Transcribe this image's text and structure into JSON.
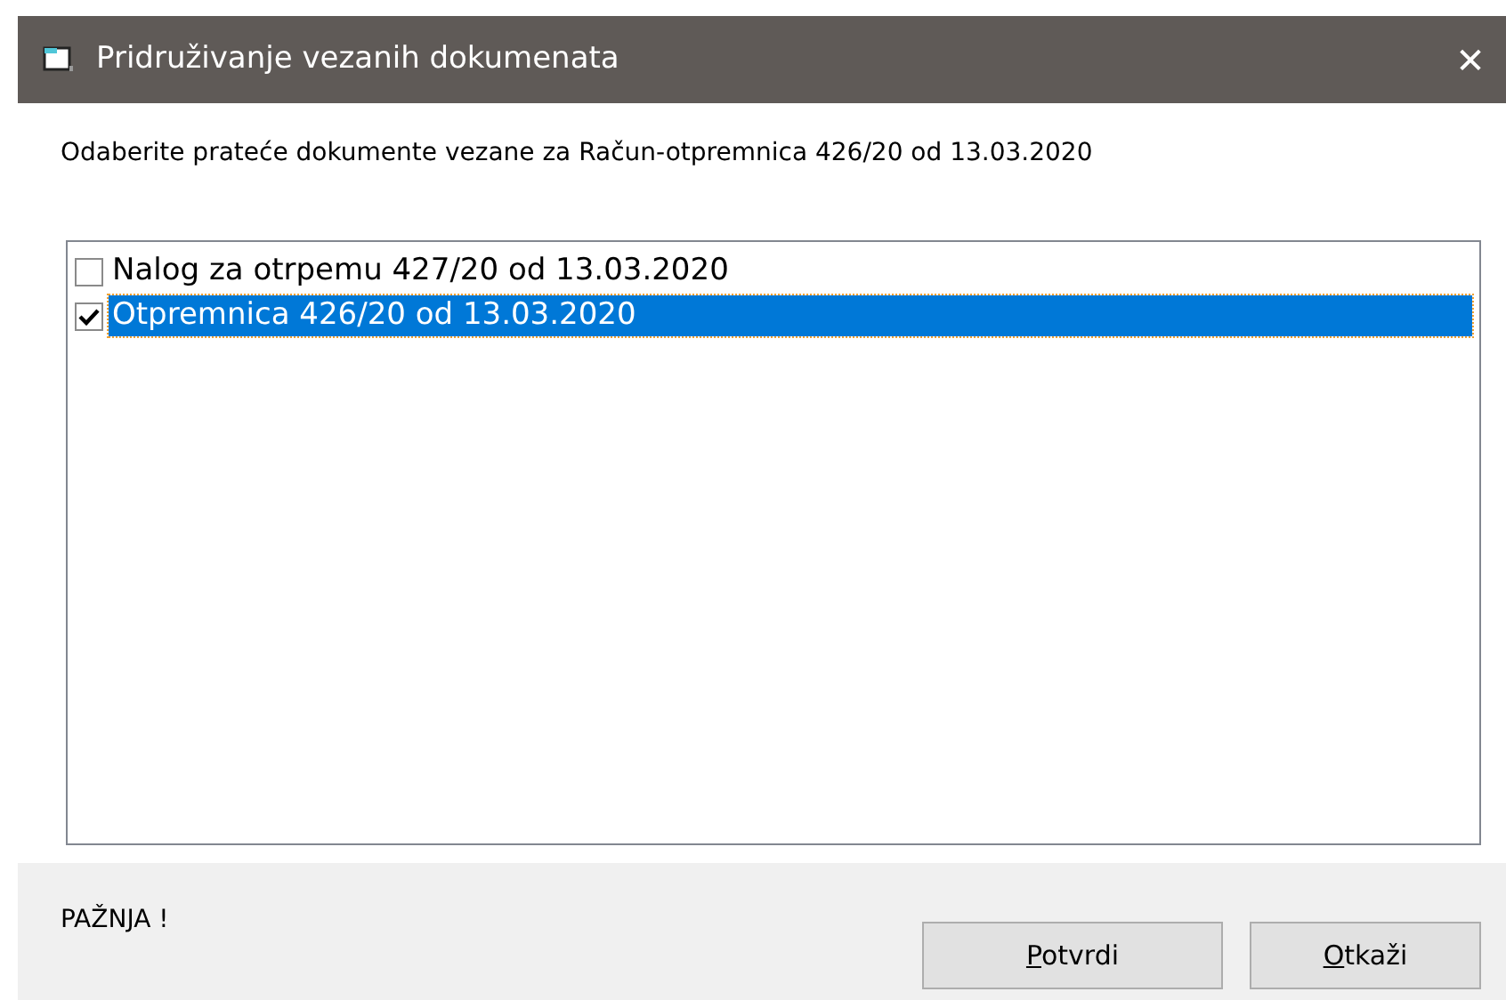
{
  "window": {
    "title": "Pridruživanje vezanih dokumenata",
    "close": "✕"
  },
  "prompt": "Odaberite prateće dokumente vezane za Račun-otpremnica 426/20 od 13.03.2020",
  "documents": [
    {
      "label": "Nalog za otrpemu 427/20 od 13.03.2020",
      "checked": false,
      "selected": false
    },
    {
      "label": "Otpremnica 426/20 od 13.03.2020",
      "checked": true,
      "selected": true
    }
  ],
  "warning": "PAŽNJA !",
  "buttons": [
    {
      "access_key": "P",
      "label_rest": "otvrdi"
    },
    {
      "access_key": "O",
      "label_rest": "tkaži"
    }
  ]
}
